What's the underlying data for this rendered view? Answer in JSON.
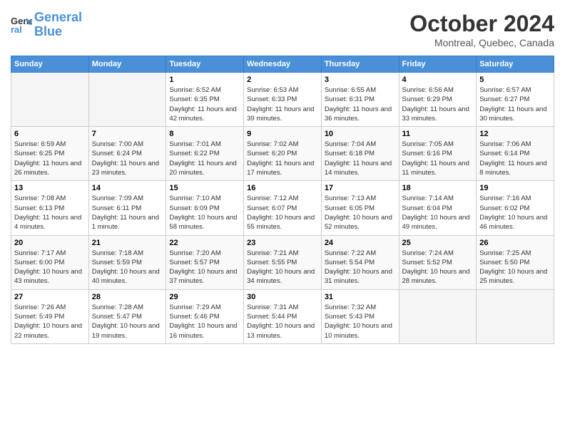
{
  "header": {
    "logo_line1": "General",
    "logo_line2": "Blue",
    "month": "October 2024",
    "location": "Montreal, Quebec, Canada"
  },
  "weekdays": [
    "Sunday",
    "Monday",
    "Tuesday",
    "Wednesday",
    "Thursday",
    "Friday",
    "Saturday"
  ],
  "weeks": [
    [
      {
        "day": "",
        "info": ""
      },
      {
        "day": "",
        "info": ""
      },
      {
        "day": "1",
        "info": "Sunrise: 6:52 AM\nSunset: 6:35 PM\nDaylight: 11 hours and 42 minutes."
      },
      {
        "day": "2",
        "info": "Sunrise: 6:53 AM\nSunset: 6:33 PM\nDaylight: 11 hours and 39 minutes."
      },
      {
        "day": "3",
        "info": "Sunrise: 6:55 AM\nSunset: 6:31 PM\nDaylight: 11 hours and 36 minutes."
      },
      {
        "day": "4",
        "info": "Sunrise: 6:56 AM\nSunset: 6:29 PM\nDaylight: 11 hours and 33 minutes."
      },
      {
        "day": "5",
        "info": "Sunrise: 6:57 AM\nSunset: 6:27 PM\nDaylight: 11 hours and 30 minutes."
      }
    ],
    [
      {
        "day": "6",
        "info": "Sunrise: 6:59 AM\nSunset: 6:25 PM\nDaylight: 11 hours and 26 minutes."
      },
      {
        "day": "7",
        "info": "Sunrise: 7:00 AM\nSunset: 6:24 PM\nDaylight: 11 hours and 23 minutes."
      },
      {
        "day": "8",
        "info": "Sunrise: 7:01 AM\nSunset: 6:22 PM\nDaylight: 11 hours and 20 minutes."
      },
      {
        "day": "9",
        "info": "Sunrise: 7:02 AM\nSunset: 6:20 PM\nDaylight: 11 hours and 17 minutes."
      },
      {
        "day": "10",
        "info": "Sunrise: 7:04 AM\nSunset: 6:18 PM\nDaylight: 11 hours and 14 minutes."
      },
      {
        "day": "11",
        "info": "Sunrise: 7:05 AM\nSunset: 6:16 PM\nDaylight: 11 hours and 11 minutes."
      },
      {
        "day": "12",
        "info": "Sunrise: 7:06 AM\nSunset: 6:14 PM\nDaylight: 11 hours and 8 minutes."
      }
    ],
    [
      {
        "day": "13",
        "info": "Sunrise: 7:08 AM\nSunset: 6:13 PM\nDaylight: 11 hours and 4 minutes."
      },
      {
        "day": "14",
        "info": "Sunrise: 7:09 AM\nSunset: 6:11 PM\nDaylight: 11 hours and 1 minute."
      },
      {
        "day": "15",
        "info": "Sunrise: 7:10 AM\nSunset: 6:09 PM\nDaylight: 10 hours and 58 minutes."
      },
      {
        "day": "16",
        "info": "Sunrise: 7:12 AM\nSunset: 6:07 PM\nDaylight: 10 hours and 55 minutes."
      },
      {
        "day": "17",
        "info": "Sunrise: 7:13 AM\nSunset: 6:05 PM\nDaylight: 10 hours and 52 minutes."
      },
      {
        "day": "18",
        "info": "Sunrise: 7:14 AM\nSunset: 6:04 PM\nDaylight: 10 hours and 49 minutes."
      },
      {
        "day": "19",
        "info": "Sunrise: 7:16 AM\nSunset: 6:02 PM\nDaylight: 10 hours and 46 minutes."
      }
    ],
    [
      {
        "day": "20",
        "info": "Sunrise: 7:17 AM\nSunset: 6:00 PM\nDaylight: 10 hours and 43 minutes."
      },
      {
        "day": "21",
        "info": "Sunrise: 7:18 AM\nSunset: 5:59 PM\nDaylight: 10 hours and 40 minutes."
      },
      {
        "day": "22",
        "info": "Sunrise: 7:20 AM\nSunset: 5:57 PM\nDaylight: 10 hours and 37 minutes."
      },
      {
        "day": "23",
        "info": "Sunrise: 7:21 AM\nSunset: 5:55 PM\nDaylight: 10 hours and 34 minutes."
      },
      {
        "day": "24",
        "info": "Sunrise: 7:22 AM\nSunset: 5:54 PM\nDaylight: 10 hours and 31 minutes."
      },
      {
        "day": "25",
        "info": "Sunrise: 7:24 AM\nSunset: 5:52 PM\nDaylight: 10 hours and 28 minutes."
      },
      {
        "day": "26",
        "info": "Sunrise: 7:25 AM\nSunset: 5:50 PM\nDaylight: 10 hours and 25 minutes."
      }
    ],
    [
      {
        "day": "27",
        "info": "Sunrise: 7:26 AM\nSunset: 5:49 PM\nDaylight: 10 hours and 22 minutes."
      },
      {
        "day": "28",
        "info": "Sunrise: 7:28 AM\nSunset: 5:47 PM\nDaylight: 10 hours and 19 minutes."
      },
      {
        "day": "29",
        "info": "Sunrise: 7:29 AM\nSunset: 5:46 PM\nDaylight: 10 hours and 16 minutes."
      },
      {
        "day": "30",
        "info": "Sunrise: 7:31 AM\nSunset: 5:44 PM\nDaylight: 10 hours and 13 minutes."
      },
      {
        "day": "31",
        "info": "Sunrise: 7:32 AM\nSunset: 5:43 PM\nDaylight: 10 hours and 10 minutes."
      },
      {
        "day": "",
        "info": ""
      },
      {
        "day": "",
        "info": ""
      }
    ]
  ]
}
